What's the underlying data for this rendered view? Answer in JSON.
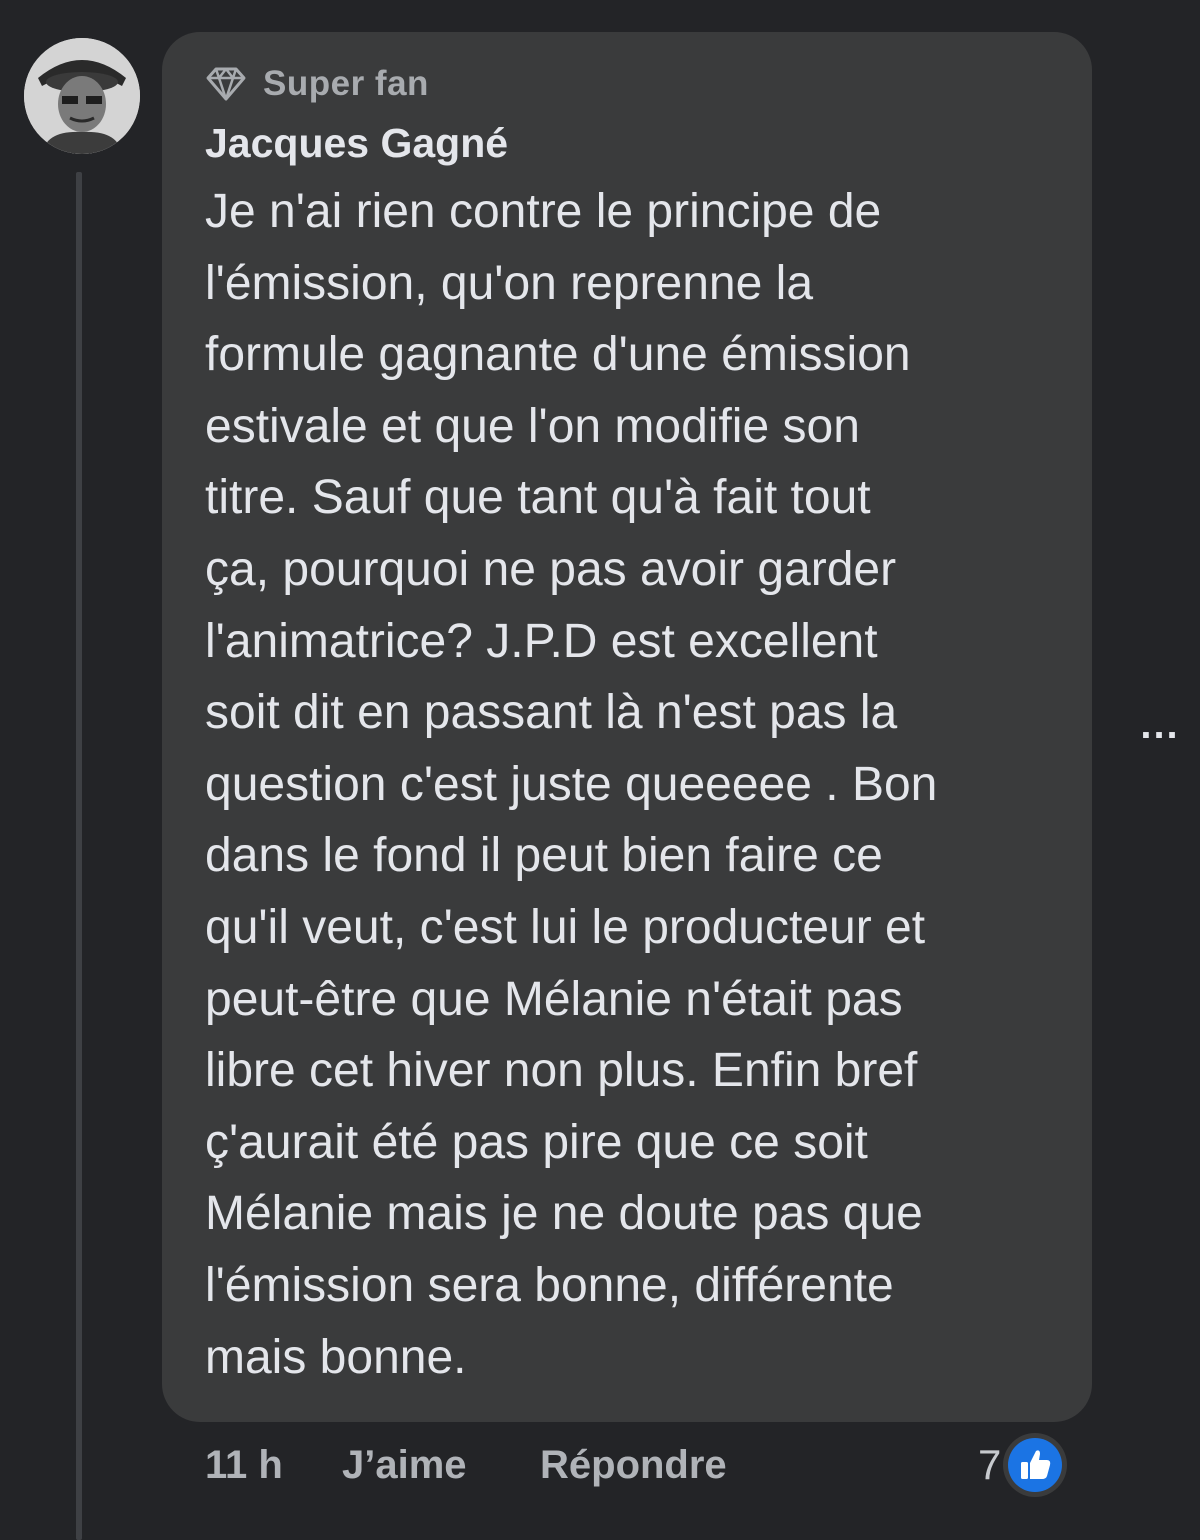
{
  "comment": {
    "badge": {
      "icon": "diamond-icon",
      "label": "Super fan"
    },
    "author": "Jacques Gagné",
    "text_lines": [
      "Je n'ai rien contre le principe de",
      "l'émission, qu'on reprenne la",
      "formule gagnante d'une émission",
      "estivale et que l'on modifie son",
      "titre. Sauf que tant qu'à fait tout",
      "ça, pourquoi ne pas avoir garder",
      "l'animatrice? J.P.D est excellent",
      "soit dit en passant là n'est pas la",
      "question c'est juste queeeee . Bon",
      "dans le fond il peut bien faire ce",
      "qu'il veut, c'est lui le producteur et",
      "peut-être que Mélanie n'était pas",
      "libre cet hiver non plus. Enfin bref",
      "ç'aurait été pas pire que ce soit",
      "Mélanie mais je ne doute pas que",
      "l'émission sera bonne, différente",
      "mais bonne."
    ],
    "more_button": "...",
    "timestamp": "11 h",
    "like_label": "J’aime",
    "reply_label": "Répondre",
    "reactions": {
      "count": "7",
      "icon": "thumbs-up-icon",
      "color": "#1b74e4"
    }
  }
}
